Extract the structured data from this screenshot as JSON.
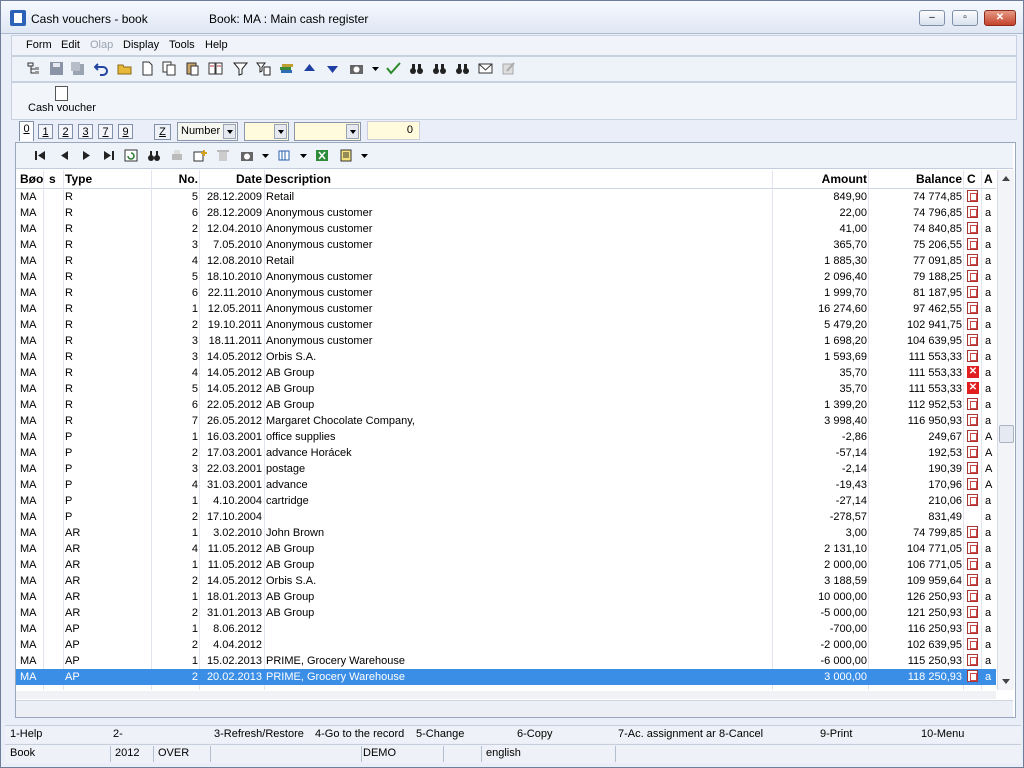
{
  "window": {
    "title": "Cash vouchers - book",
    "book_title": "Book: MA : Main cash register"
  },
  "menu": [
    "Form",
    "Edit",
    "Olap",
    "Display",
    "Tools",
    "Help"
  ],
  "toolbar2": {
    "cash_voucher_label": "Cash voucher"
  },
  "page_tabs": [
    "0",
    "1",
    "2",
    "3",
    "7",
    "9"
  ],
  "filter": {
    "z_label": "Z",
    "sort_field": "Number",
    "number_value": "0"
  },
  "columns": {
    "book": "Bøo",
    "s": "s",
    "type": "Type",
    "no": "No.",
    "date": "Date",
    "description": "Description",
    "amount": "Amount",
    "balance": "Balance",
    "c": "C",
    "a": "A"
  },
  "rows": [
    {
      "book": "MA",
      "type": "R",
      "no": "5",
      "date": "28.12.2009",
      "desc": "Retail",
      "amount": "849,90",
      "balance": "74 774,85",
      "c": "doc",
      "a": "a"
    },
    {
      "book": "MA",
      "type": "R",
      "no": "6",
      "date": "28.12.2009",
      "desc": "Anonymous customer",
      "amount": "22,00",
      "balance": "74 796,85",
      "c": "doc",
      "a": "a"
    },
    {
      "book": "MA",
      "type": "R",
      "no": "2",
      "date": "12.04.2010",
      "desc": "Anonymous customer",
      "amount": "41,00",
      "balance": "74 840,85",
      "c": "doc",
      "a": "a"
    },
    {
      "book": "MA",
      "type": "R",
      "no": "3",
      "date": "7.05.2010",
      "desc": "Anonymous customer",
      "amount": "365,70",
      "balance": "75 206,55",
      "c": "doc",
      "a": "a"
    },
    {
      "book": "MA",
      "type": "R",
      "no": "4",
      "date": "12.08.2010",
      "desc": "Retail",
      "amount": "1 885,30",
      "balance": "77 091,85",
      "c": "doc",
      "a": "a"
    },
    {
      "book": "MA",
      "type": "R",
      "no": "5",
      "date": "18.10.2010",
      "desc": "Anonymous customer",
      "amount": "2 096,40",
      "balance": "79 188,25",
      "c": "doc",
      "a": "a"
    },
    {
      "book": "MA",
      "type": "R",
      "no": "6",
      "date": "22.11.2010",
      "desc": "Anonymous customer",
      "amount": "1 999,70",
      "balance": "81 187,95",
      "c": "doc",
      "a": "a"
    },
    {
      "book": "MA",
      "type": "R",
      "no": "1",
      "date": "12.05.2011",
      "desc": "Anonymous customer",
      "amount": "16 274,60",
      "balance": "97 462,55",
      "c": "doc",
      "a": "a"
    },
    {
      "book": "MA",
      "type": "R",
      "no": "2",
      "date": "19.10.2011",
      "desc": "Anonymous customer",
      "amount": "5 479,20",
      "balance": "102 941,75",
      "c": "doc",
      "a": "a"
    },
    {
      "book": "MA",
      "type": "R",
      "no": "3",
      "date": "18.11.2011",
      "desc": "Anonymous customer",
      "amount": "1 698,20",
      "balance": "104 639,95",
      "c": "doc",
      "a": "a"
    },
    {
      "book": "MA",
      "type": "R",
      "no": "3",
      "date": "14.05.2012",
      "desc": "Orbis S.A.",
      "amount": "1 593,69",
      "balance": "111 553,33",
      "c": "doc",
      "a": "a"
    },
    {
      "book": "MA",
      "type": "R",
      "no": "4",
      "date": "14.05.2012",
      "desc": "AB Group",
      "amount": "35,70",
      "balance": "111 553,33",
      "c": "x",
      "a": "a"
    },
    {
      "book": "MA",
      "type": "R",
      "no": "5",
      "date": "14.05.2012",
      "desc": "AB Group",
      "amount": "35,70",
      "balance": "111 553,33",
      "c": "x",
      "a": "a"
    },
    {
      "book": "MA",
      "type": "R",
      "no": "6",
      "date": "22.05.2012",
      "desc": "AB Group",
      "amount": "1 399,20",
      "balance": "112 952,53",
      "c": "doc",
      "a": "a"
    },
    {
      "book": "MA",
      "type": "R",
      "no": "7",
      "date": "26.05.2012",
      "desc": "Margaret Chocolate Company,",
      "amount": "3 998,40",
      "balance": "116 950,93",
      "c": "doc",
      "a": "a"
    },
    {
      "book": "MA",
      "type": "P",
      "no": "1",
      "date": "16.03.2001",
      "desc": "office supplies",
      "amount": "-2,86",
      "balance": "249,67",
      "c": "doc",
      "a": "A"
    },
    {
      "book": "MA",
      "type": "P",
      "no": "2",
      "date": "17.03.2001",
      "desc": "advance Horácek",
      "amount": "-57,14",
      "balance": "192,53",
      "c": "doc",
      "a": "A"
    },
    {
      "book": "MA",
      "type": "P",
      "no": "3",
      "date": "22.03.2001",
      "desc": "postage",
      "amount": "-2,14",
      "balance": "190,39",
      "c": "doc",
      "a": "A"
    },
    {
      "book": "MA",
      "type": "P",
      "no": "4",
      "date": "31.03.2001",
      "desc": "advance",
      "amount": "-19,43",
      "balance": "170,96",
      "c": "doc",
      "a": "A"
    },
    {
      "book": "MA",
      "type": "P",
      "no": "1",
      "date": "4.10.2004",
      "desc": "cartridge",
      "amount": "-27,14",
      "balance": "210,06",
      "c": "doc",
      "a": "a"
    },
    {
      "book": "MA",
      "type": "P",
      "no": "2",
      "date": "17.10.2004",
      "desc": "",
      "amount": "-278,57",
      "balance": "831,49",
      "c": "",
      "a": "a"
    },
    {
      "book": "MA",
      "type": "AR",
      "no": "1",
      "date": "3.02.2010",
      "desc": "John Brown",
      "amount": "3,00",
      "balance": "74 799,85",
      "c": "doc",
      "a": "a"
    },
    {
      "book": "MA",
      "type": "AR",
      "no": "4",
      "date": "11.05.2012",
      "desc": "AB Group",
      "amount": "2 131,10",
      "balance": "104 771,05",
      "c": "doc",
      "a": "a"
    },
    {
      "book": "MA",
      "type": "AR",
      "no": "1",
      "date": "11.05.2012",
      "desc": "AB Group",
      "amount": "2 000,00",
      "balance": "106 771,05",
      "c": "doc",
      "a": "a"
    },
    {
      "book": "MA",
      "type": "AR",
      "no": "2",
      "date": "14.05.2012",
      "desc": "Orbis S.A.",
      "amount": "3 188,59",
      "balance": "109 959,64",
      "c": "doc",
      "a": "a"
    },
    {
      "book": "MA",
      "type": "AR",
      "no": "1",
      "date": "18.01.2013",
      "desc": "AB Group",
      "amount": "10 000,00",
      "balance": "126 250,93",
      "c": "doc",
      "a": "a"
    },
    {
      "book": "MA",
      "type": "AR",
      "no": "2",
      "date": "31.01.2013",
      "desc": "AB Group",
      "amount": "-5 000,00",
      "balance": "121 250,93",
      "c": "doc",
      "a": "a"
    },
    {
      "book": "MA",
      "type": "AP",
      "no": "1",
      "date": "8.06.2012",
      "desc": "",
      "amount": "-700,00",
      "balance": "116 250,93",
      "c": "doc",
      "a": "a"
    },
    {
      "book": "MA",
      "type": "AP",
      "no": "2",
      "date": "4.04.2012",
      "desc": "",
      "amount": "-2 000,00",
      "balance": "102 639,95",
      "c": "doc",
      "a": "a"
    },
    {
      "book": "MA",
      "type": "AP",
      "no": "1",
      "date": "15.02.2013",
      "desc": "PRIME, Grocery Warehouse",
      "amount": "-6 000,00",
      "balance": "115 250,93",
      "c": "doc",
      "a": "a"
    },
    {
      "book": "MA",
      "type": "AP",
      "no": "2",
      "date": "20.02.2013",
      "desc": "PRIME, Grocery Warehouse",
      "amount": "3 000,00",
      "balance": "118 250,93",
      "c": "doc",
      "a": "a",
      "selected": true
    }
  ],
  "function_keys": [
    "1-Help",
    "2-",
    "3-Refresh/Restore",
    "4-Go to the record",
    "5-Change",
    "6-Copy",
    "7-Ac. assignment ar",
    "8-Cancel",
    "9-Print",
    "10-Menu"
  ],
  "status": {
    "mode": "Book",
    "year": "2012",
    "ins": "OVER",
    "db": "DEMO",
    "lang": "english"
  },
  "colors": {
    "selected_row": "#3b8ee6",
    "accent": "#2b62b8"
  }
}
